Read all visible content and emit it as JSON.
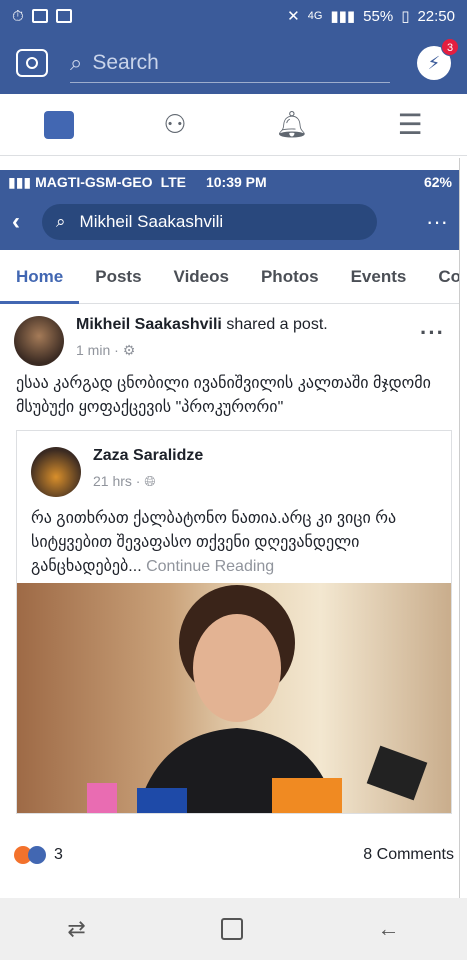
{
  "outer_status": {
    "signal": "4G",
    "battery": "55%",
    "time": "22:50"
  },
  "outer_search": {
    "placeholder": "Search"
  },
  "messenger_badge": "3",
  "inner_status": {
    "carrier": "MAGTI-GSM-GEO",
    "network": "LTE",
    "time": "10:39 PM",
    "battery": "62%"
  },
  "inner_search": {
    "query": "Mikheil Saakashvili"
  },
  "tabs": [
    {
      "label": "Home"
    },
    {
      "label": "Posts"
    },
    {
      "label": "Videos"
    },
    {
      "label": "Photos"
    },
    {
      "label": "Events"
    },
    {
      "label": "Co"
    }
  ],
  "post": {
    "author": "Mikheil Saakashvili",
    "action": "shared a post.",
    "time": "1 min ·",
    "text": "ესაა კარგად ცნობილი ივანიშვილის კალთაში მჯდომი მსუბუქი ყოფაქცევის \"პროკურორი\"",
    "shared_author": "Zaza Saralidze",
    "shared_time": "21 hrs ·",
    "shared_text": "რა გითხრათ ქალბატონო ნათია.არც კი ვიცი რა სიტყვებით შევაფასო თქვენი დღევანდელი განცხადებებ...",
    "continue": "Continue Reading",
    "reaction_count": "3",
    "comments": "8 Comments"
  },
  "colors": {
    "brand": "#3b5b9a",
    "active_tab": "#4267b2"
  }
}
